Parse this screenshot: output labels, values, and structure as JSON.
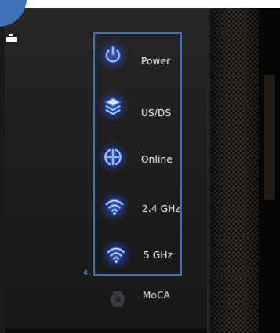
{
  "indicators": [
    {
      "label": "Power",
      "icon": "power-icon",
      "lit": true
    },
    {
      "label": "US/DS",
      "icon": "layers-icon",
      "lit": true
    },
    {
      "label": "Online",
      "icon": "globe-arrows-icon",
      "lit": true
    },
    {
      "label": "2.4 GHz",
      "icon": "wifi-icon",
      "lit": true
    },
    {
      "label": "5 GHz",
      "icon": "wifi-icon",
      "lit": true
    },
    {
      "label": "MoCA",
      "icon": "moca-icon",
      "lit": false
    }
  ],
  "annotation": {
    "number": "4."
  },
  "colors": {
    "led_blue": "#3f7bff",
    "led_core": "#dbe8ff",
    "highlight_box": "#3a73c0",
    "badge": "#3f73b9"
  }
}
